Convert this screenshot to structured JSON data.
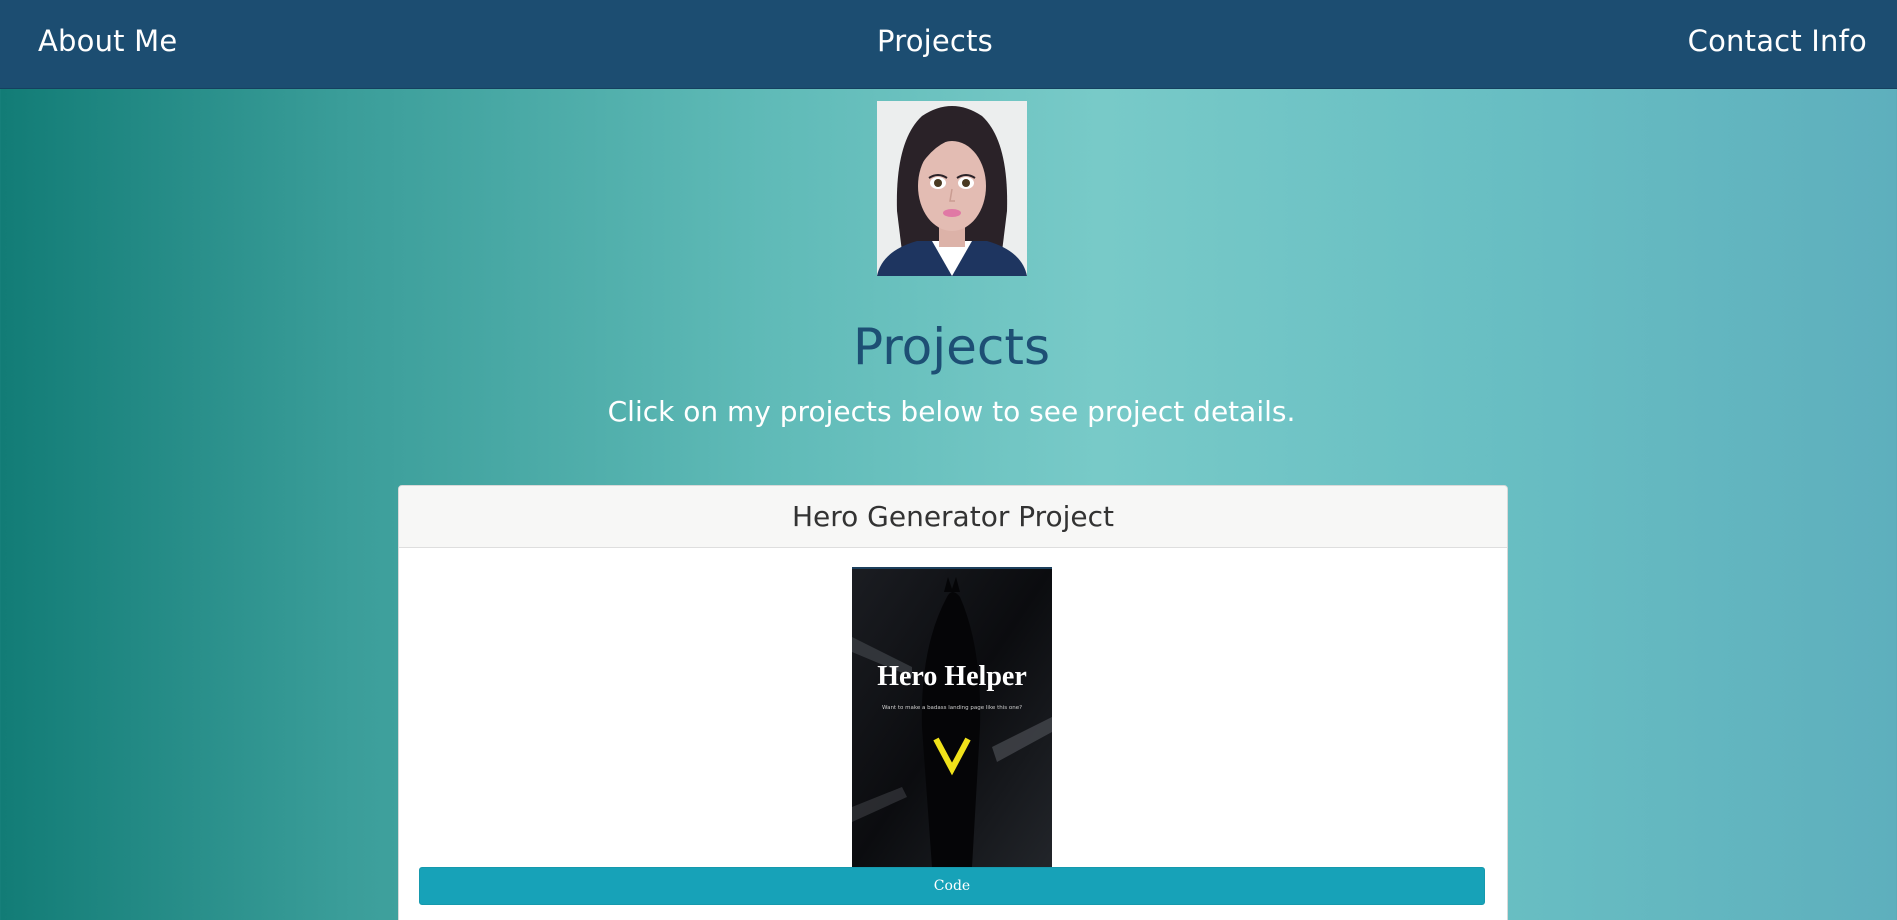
{
  "nav": {
    "about": "About Me",
    "projects": "Projects",
    "contact": "Contact Info"
  },
  "header": {
    "title": "Projects",
    "subtitle": "Click on my projects below to see project details."
  },
  "projects": [
    {
      "title": "Hero Generator Project",
      "thumbnail": {
        "heading": "Hero Helper",
        "tagline": "Want to make a badass landing page like this one?"
      },
      "button_label": "Code"
    }
  ],
  "colors": {
    "navbar": "#1c4d71",
    "title": "#1d4f74",
    "button": "#17a2b8",
    "chevron": "#f1e21a"
  }
}
